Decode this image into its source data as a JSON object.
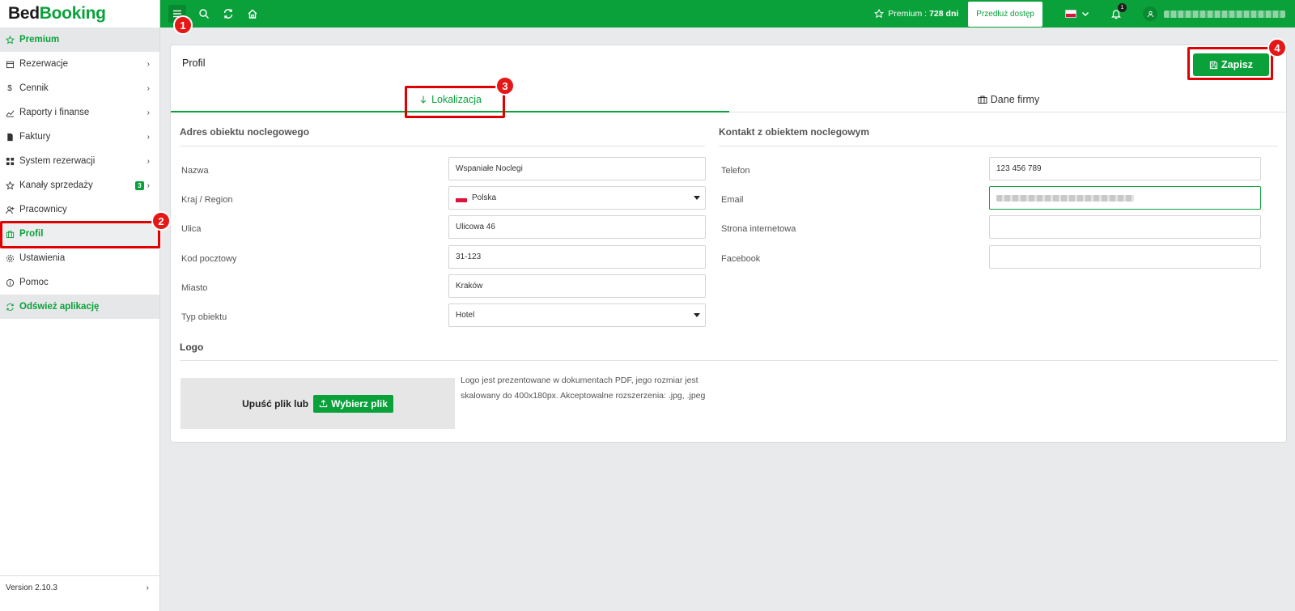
{
  "brand": {
    "part1": "Bed",
    "part2": "Booking"
  },
  "sidebar": {
    "items": [
      {
        "label": "Premium",
        "icon": "star-icon",
        "chevron": ""
      },
      {
        "label": "Rezerwacje",
        "icon": "calendar-icon",
        "chevron": "›"
      },
      {
        "label": "Cennik",
        "icon": "dollar-icon",
        "chevron": "›"
      },
      {
        "label": "Raporty i finanse",
        "icon": "chart-icon",
        "chevron": "›"
      },
      {
        "label": "Faktury",
        "icon": "invoice-icon",
        "chevron": "›"
      },
      {
        "label": "System rezerwacji",
        "icon": "grid-icon",
        "chevron": "›"
      },
      {
        "label": "Kanały sprzedaży",
        "icon": "star-outline-icon",
        "chevron": "›",
        "badge": "3"
      },
      {
        "label": "Pracownicy",
        "icon": "user-plus-icon",
        "chevron": ""
      },
      {
        "label": "Profil",
        "icon": "building-icon",
        "chevron": ""
      },
      {
        "label": "Ustawienia",
        "icon": "gear-icon",
        "chevron": ""
      },
      {
        "label": "Pomoc",
        "icon": "info-icon",
        "chevron": ""
      },
      {
        "label": "Odśwież aplikację",
        "icon": "refresh-icon",
        "chevron": ""
      }
    ],
    "version": "Version 2.10.3",
    "version_chevron": "›"
  },
  "topbar": {
    "premium_label": "Premium :",
    "premium_days": "728 dni",
    "extend_label": "Przedłuż dostęp",
    "notifications_count": "1"
  },
  "card": {
    "title": "Profil",
    "save_label": "Zapisz",
    "tabs": [
      {
        "label": "Lokalizacja",
        "icon": "arrow-down-icon"
      },
      {
        "label": "Dane firmy",
        "icon": "briefcase-icon"
      }
    ]
  },
  "address": {
    "title": "Adres obiektu noclegowego",
    "fields": [
      {
        "label": "Nazwa",
        "value": "Wspaniałe Noclegi"
      },
      {
        "label": "Kraj / Region",
        "value": "Polska"
      },
      {
        "label": "Ulica",
        "value": "Ulicowa 46"
      },
      {
        "label": "Kod pocztowy",
        "value": "31-123"
      },
      {
        "label": "Miasto",
        "value": "Kraków"
      },
      {
        "label": "Typ obiektu",
        "value": "Hotel"
      }
    ]
  },
  "contact": {
    "title": "Kontakt z obiektem noclegowym",
    "fields": [
      {
        "label": "Telefon",
        "value": "123 456 789"
      },
      {
        "label": "Email",
        "value": ""
      },
      {
        "label": "Strona internetowa",
        "value": ""
      },
      {
        "label": "Facebook",
        "value": ""
      }
    ]
  },
  "logo": {
    "title": "Logo",
    "drop_text": "Upuść plik lub",
    "choose_label": "Wybierz plik",
    "description": "Logo jest prezentowane w dokumentach PDF, jego rozmiar jest skalowany do 400x180px. Akceptowalne rozszerzenia: .jpg, .jpeg"
  },
  "annotations": [
    "1",
    "2",
    "3",
    "4"
  ],
  "colors": {
    "accent": "#0aa13b",
    "annotation": "#e00000"
  }
}
